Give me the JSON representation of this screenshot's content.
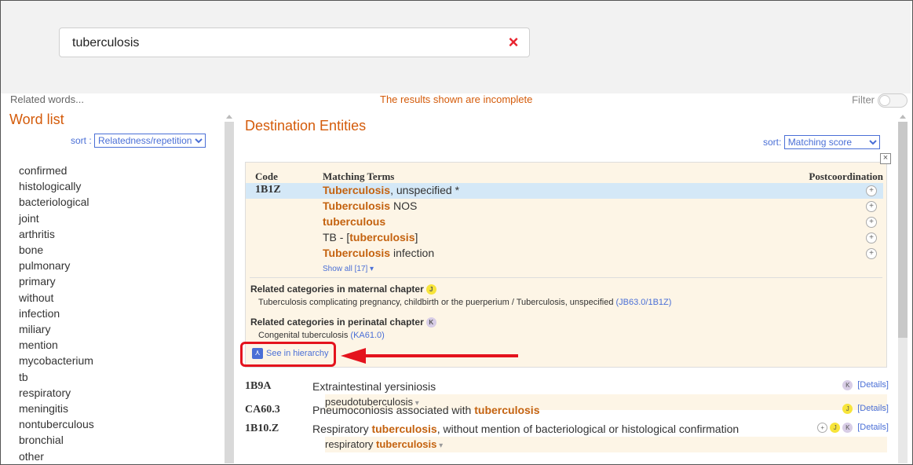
{
  "search": {
    "value": "tuberculosis",
    "clear_icon": "×"
  },
  "infobar": {
    "related_words": "Related words...",
    "incomplete": "The results shown are incomplete",
    "filter_label": "Filter"
  },
  "word_list": {
    "title": "Word list",
    "sort_label": "sort :",
    "sort_value": "Relatedness/repetition",
    "words": [
      "confirmed",
      "histologically",
      "bacteriological",
      "joint",
      "arthritis",
      "bone",
      "pulmonary",
      "primary",
      "without",
      "infection",
      "miliary",
      "mention",
      "mycobacterium",
      "tb",
      "respiratory",
      "meningitis",
      "nontuberculous",
      "bronchial",
      "other"
    ]
  },
  "destination": {
    "title": "Destination Entities",
    "sort_label": "sort:",
    "sort_value": "Matching score",
    "headers": {
      "code": "Code",
      "matching_terms": "Matching Terms",
      "postcoordination": "Postcoordination"
    },
    "main_code": "1B1Z",
    "terms": [
      {
        "hi": "Tuberculosis",
        "rest": ", unspecified *"
      },
      {
        "hi": "Tuberculosis",
        "rest": " NOS"
      },
      {
        "hi": "tuberculous",
        "rest": ""
      },
      {
        "pre": "TB - [",
        "hi": "tuberculosis",
        "rest": "]"
      },
      {
        "hi": "Tuberculosis",
        "rest": " infection"
      }
    ],
    "show_all": "Show all [17] ▾",
    "maternal": {
      "heading": "Related categories in maternal chapter",
      "badge": "J",
      "text": "Tuberculosis complicating pregnancy, childbirth or the puerperium / Tuberculosis, unspecified",
      "link": "(JB63.0/1B1Z)"
    },
    "perinatal": {
      "heading": "Related categories in perinatal chapter",
      "badge": "K",
      "text": "Congenital tuberculosis",
      "link": "(KA61.0)"
    },
    "hierarchy_button": "See in hierarchy",
    "entities": [
      {
        "code": "1B9A",
        "title_pre": "Extraintestinal yersiniosis",
        "title_hi": "",
        "title_post": "",
        "sub_pre": "pseudotuberculosis",
        "sub_hi": "",
        "badges": [
          "K"
        ],
        "details": "[Details]"
      },
      {
        "code": "CA60.3",
        "title_pre": "Pneumoconiosis associated with ",
        "title_hi": "tuberculosis",
        "title_post": "",
        "sub_pre": "",
        "sub_hi": "",
        "badges": [
          "J"
        ],
        "details": "[Details]"
      },
      {
        "code": "1B10.Z",
        "title_pre": "Respiratory ",
        "title_hi": "tuberculosis",
        "title_post": ", without mention of bacteriological or histological confirmation",
        "sub_pre": "respiratory ",
        "sub_hi": "tuberculosis",
        "badges": [
          "+",
          "J",
          "K"
        ],
        "details": "[Details]"
      }
    ]
  }
}
